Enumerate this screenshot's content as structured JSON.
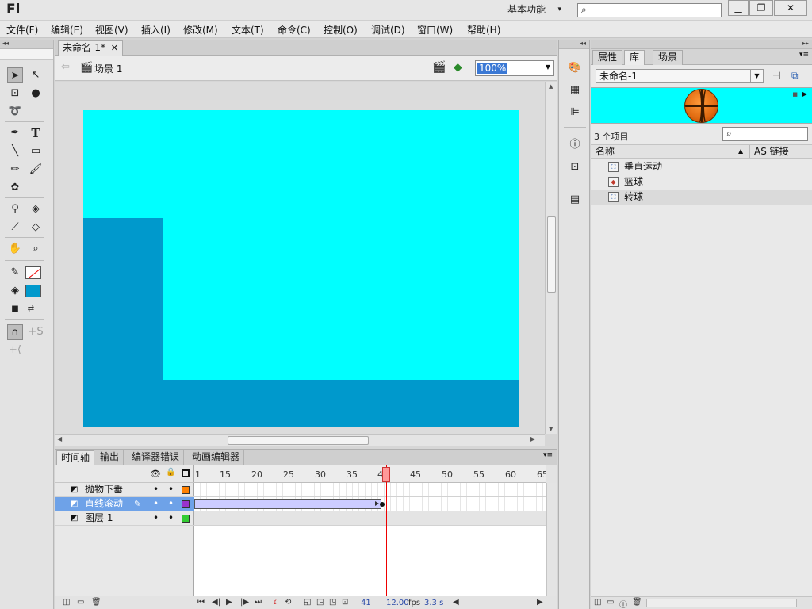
{
  "titlebar": {
    "app_logo": "Fl",
    "workspace": "基本功能",
    "search_icon": "search-icon"
  },
  "menu": [
    "文件(F)",
    "编辑(E)",
    "视图(V)",
    "插入(I)",
    "修改(M)",
    "文本(T)",
    "命令(C)",
    "控制(O)",
    "调试(D)",
    "窗口(W)",
    "帮助(H)"
  ],
  "document": {
    "tab_title": "未命名-1*",
    "scene_label": "场景 1",
    "zoom": "100%",
    "stage_color": "#00ffff",
    "shape_color": "#0099cc"
  },
  "tools": {
    "stroke_color": "#ffffff",
    "fill_color": "#0099cc"
  },
  "timeline": {
    "tabs": [
      "时间轴",
      "输出",
      "编译器错误",
      "动画编辑器"
    ],
    "ruler_ticks": [
      "1",
      "15",
      "20",
      "25",
      "30",
      "35",
      "40",
      "45",
      "50",
      "55",
      "60",
      "65"
    ],
    "layers": [
      {
        "name": "抛物下垂",
        "color": "#ff8000",
        "selected": false
      },
      {
        "name": "直线滚动",
        "color": "#9933cc",
        "selected": true
      },
      {
        "name": "图层 1",
        "color": "#33cc33",
        "selected": false
      }
    ],
    "current_frame": "41",
    "fps": "12.00",
    "fps_unit": "fps",
    "elapsed": "3.3 s"
  },
  "panel": {
    "tabs": [
      "属性",
      "库",
      "场景"
    ],
    "library_name": "未命名-1",
    "item_count": "3 个项目",
    "col_name": "名称",
    "col_linkage": "AS 链接",
    "items": [
      {
        "name": "垂直运动",
        "selected": false
      },
      {
        "name": "篮球",
        "selected": false
      },
      {
        "name": "转球",
        "selected": true
      }
    ]
  }
}
